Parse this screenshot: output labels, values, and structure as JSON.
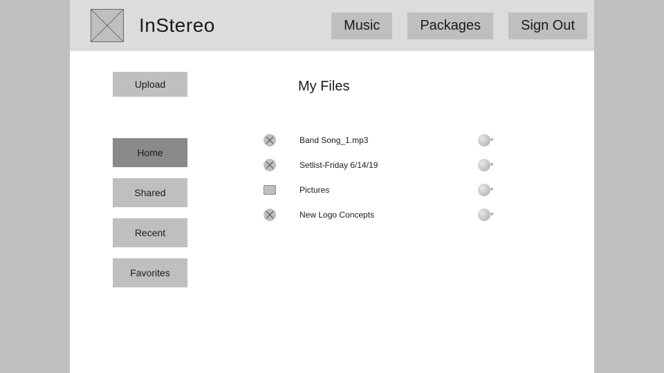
{
  "app_name": "InStereo",
  "header": {
    "nav": [
      "Music",
      "Packages",
      "Sign Out"
    ]
  },
  "sidebar": {
    "upload_label": "Upload",
    "items": [
      {
        "label": "Home",
        "active": true
      },
      {
        "label": "Shared",
        "active": false
      },
      {
        "label": "Recent",
        "active": false
      },
      {
        "label": "Favorites",
        "active": false
      }
    ]
  },
  "main": {
    "title": "My Files",
    "files": [
      {
        "name": "Band Song_1.mp3",
        "icon": "x"
      },
      {
        "name": "Setlist-Friday 6/14/19",
        "icon": "x"
      },
      {
        "name": "Pictures",
        "icon": "folder"
      },
      {
        "name": "New Logo Concepts",
        "icon": "x"
      }
    ]
  }
}
